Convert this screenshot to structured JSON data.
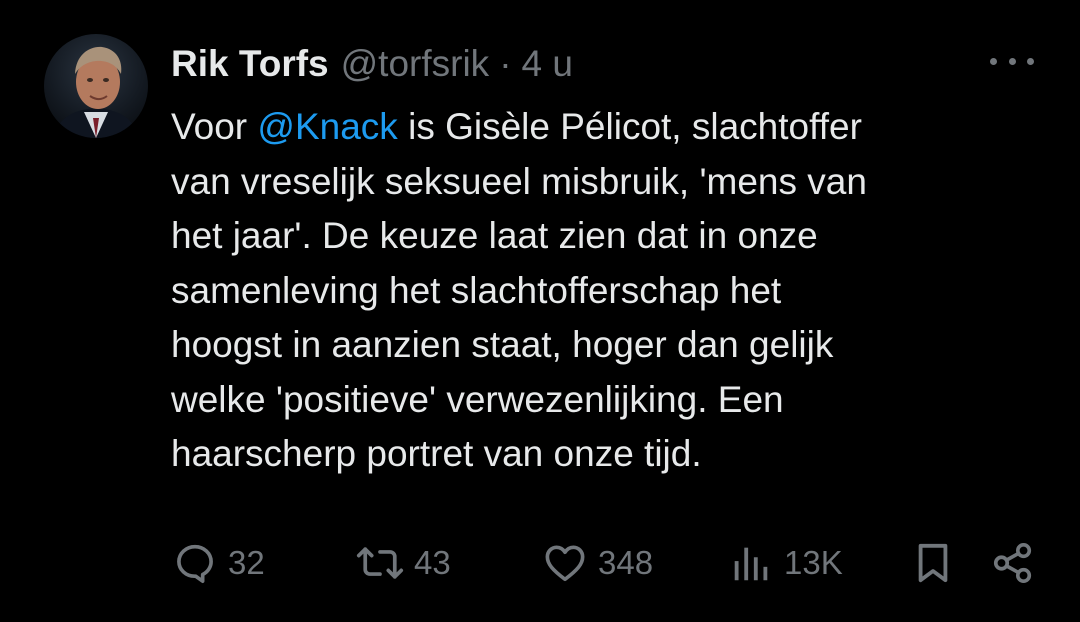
{
  "tweet": {
    "author_name": "Rik Torfs",
    "handle": "@torfsrik",
    "separator": "·",
    "time": "4 u",
    "body_lines": [
      {
        "pre": "Voor ",
        "mention": "@Knack",
        "post": " is Gisèle Pélicot, slachtoffer"
      },
      {
        "text": "van vreselijk seksueel misbruik, 'mens van"
      },
      {
        "text": "het jaar'. De keuze laat zien dat in onze"
      },
      {
        "text": "samenleving het slachtofferschap het"
      },
      {
        "text": "hoogst in aanzien staat, hoger dan gelijk"
      },
      {
        "text": "welke 'positieve' verwezenlijking. Een"
      },
      {
        "text": "haarscherp portret van onze tijd."
      }
    ]
  },
  "actions": {
    "replies": "32",
    "reposts": "43",
    "likes": "348",
    "views": "13K"
  },
  "icons": {
    "more": "more-horizontal-icon",
    "reply": "reply-icon",
    "repost": "repost-icon",
    "like": "heart-icon",
    "views": "views-icon",
    "bookmark": "bookmark-icon",
    "share": "share-icon"
  },
  "colors": {
    "background": "#000000",
    "text": "#e7e9ea",
    "secondary": "#71767b",
    "link": "#1d9bf0"
  }
}
